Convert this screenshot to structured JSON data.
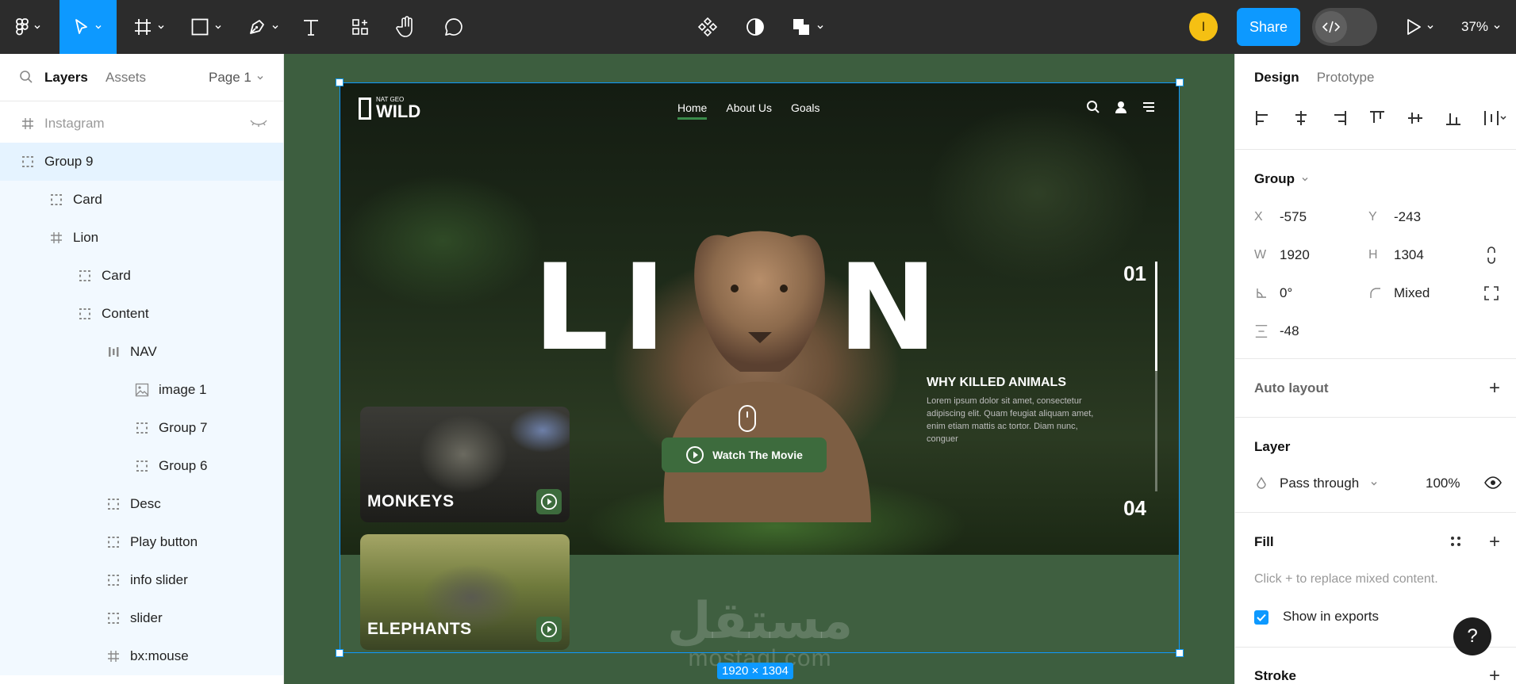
{
  "toolbar": {
    "zoom": "37%",
    "share_label": "Share",
    "avatar_initial": "I"
  },
  "left_panel": {
    "tabs": {
      "layers": "Layers",
      "assets": "Assets"
    },
    "page": "Page 1",
    "layers": [
      {
        "name": "Instagram",
        "icon": "frame-icon"
      },
      {
        "name": "Group 9",
        "icon": "group-icon"
      },
      {
        "name": "Card",
        "icon": "group-icon"
      },
      {
        "name": "Lion",
        "icon": "frame-icon"
      },
      {
        "name": "Card",
        "icon": "group-icon"
      },
      {
        "name": "Content",
        "icon": "group-icon"
      },
      {
        "name": "NAV",
        "icon": "autolayout-icon"
      },
      {
        "name": "image 1",
        "icon": "image-icon"
      },
      {
        "name": "Group 7",
        "icon": "group-icon"
      },
      {
        "name": "Group 6",
        "icon": "group-icon"
      },
      {
        "name": "Desc",
        "icon": "group-icon"
      },
      {
        "name": "Play button",
        "icon": "group-icon"
      },
      {
        "name": "info slider",
        "icon": "group-icon"
      },
      {
        "name": "slider",
        "icon": "group-icon"
      },
      {
        "name": "bx:mouse",
        "icon": "frame-icon"
      }
    ]
  },
  "canvas": {
    "logo_small": "NAT GEO",
    "logo_big": "WILD",
    "nav": [
      "Home",
      "About Us",
      "Goals"
    ],
    "hero_letters": [
      "L",
      "I",
      "N"
    ],
    "slide_start": "01",
    "slide_end": "04",
    "desc_title": "WHY KILLED ANIMALS",
    "desc_body": "Lorem ipsum dolor sit amet, consectetur adipiscing elit. Quam feugiat aliquam amet, enim etiam mattis ac tortor. Diam nunc, conguer",
    "watch_label": "Watch The Movie",
    "cards": [
      "MONKEYS",
      "ELEPHANTS"
    ],
    "watermark_ar": "مستقل",
    "watermark_lat": "mostaql.com",
    "size_label": "1920 × 1304"
  },
  "right_panel": {
    "tabs": {
      "design": "Design",
      "prototype": "Prototype"
    },
    "group_label": "Group",
    "x_label": "X",
    "x": "-575",
    "y_label": "Y",
    "y": "-243",
    "w_label": "W",
    "w": "1920",
    "h_label": "H",
    "h": "1304",
    "rotation": "0°",
    "radius": "Mixed",
    "spacing": "-48",
    "auto_layout": "Auto layout",
    "layer_title": "Layer",
    "blend": "Pass through",
    "opacity": "100%",
    "fill_title": "Fill",
    "fill_hint": "Click + to replace mixed content.",
    "show_exports": "Show in exports",
    "stroke_title": "Stroke"
  },
  "help": "?",
  "colors": {
    "accent": "#0d99ff",
    "toolbar": "#2c2c2c",
    "canvas": "#3d5e3f",
    "brand_green": "#3d6b3d"
  }
}
